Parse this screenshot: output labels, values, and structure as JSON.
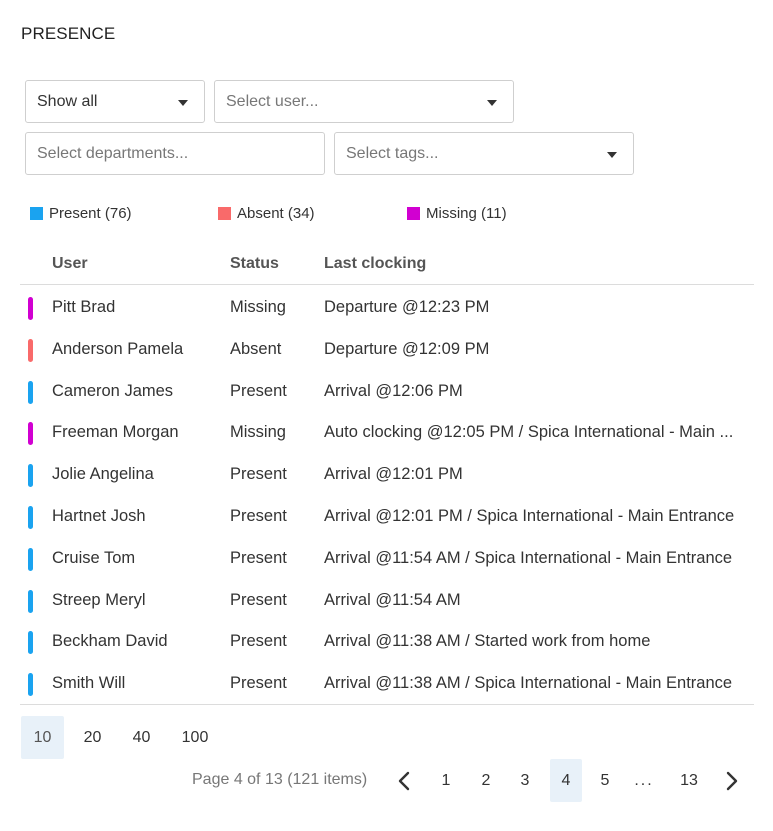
{
  "page": {
    "title": "PRESENCE"
  },
  "filters": {
    "show": {
      "value": "Show all"
    },
    "user": {
      "placeholder": "Select user..."
    },
    "departments": {
      "placeholder": "Select departments..."
    },
    "tags": {
      "placeholder": "Select tags..."
    }
  },
  "legend": [
    {
      "label": "Present (76)",
      "color": "#1aa3f0"
    },
    {
      "label": "Absent (34)",
      "color": "#f96a6a"
    },
    {
      "label": "Missing (11)",
      "color": "#d100d1"
    }
  ],
  "table": {
    "headers": {
      "user": "User",
      "status": "Status",
      "last": "Last clocking"
    },
    "rows": [
      {
        "user": "Pitt Brad",
        "status": "Missing",
        "last": "Departure @12:23 PM",
        "color": "#d100d1"
      },
      {
        "user": "Anderson Pamela",
        "status": "Absent",
        "last": "Departure @12:09 PM",
        "color": "#f96a6a"
      },
      {
        "user": "Cameron James",
        "status": "Present",
        "last": "Arrival @12:06 PM",
        "color": "#1aa3f0"
      },
      {
        "user": "Freeman Morgan",
        "status": "Missing",
        "last": "Auto clocking @12:05 PM / Spica International - Main ...",
        "color": "#d100d1"
      },
      {
        "user": "Jolie Angelina",
        "status": "Present",
        "last": "Arrival @12:01 PM",
        "color": "#1aa3f0"
      },
      {
        "user": "Hartnet Josh",
        "status": "Present",
        "last": "Arrival @12:01 PM / Spica International - Main Entrance",
        "color": "#1aa3f0"
      },
      {
        "user": "Cruise Tom",
        "status": "Present",
        "last": "Arrival @11:54 AM / Spica International - Main Entrance",
        "color": "#1aa3f0"
      },
      {
        "user": "Streep Meryl",
        "status": "Present",
        "last": "Arrival @11:54 AM",
        "color": "#1aa3f0"
      },
      {
        "user": "Beckham David",
        "status": "Present",
        "last": "Arrival @11:38 AM / Started work from home",
        "color": "#1aa3f0"
      },
      {
        "user": "Smith Will",
        "status": "Present",
        "last": "Arrival @11:38 AM / Spica International - Main Entrance",
        "color": "#1aa3f0"
      }
    ]
  },
  "pagination": {
    "page_sizes": [
      "10",
      "20",
      "40",
      "100"
    ],
    "active_page_size": "10",
    "summary": "Page 4 of 13 (121 items)",
    "pages": [
      "1",
      "2",
      "3",
      "4",
      "5",
      "...",
      "13"
    ],
    "active_page": "4",
    "icons": {
      "prev": "chevron-left-icon",
      "next": "chevron-right-icon"
    }
  }
}
